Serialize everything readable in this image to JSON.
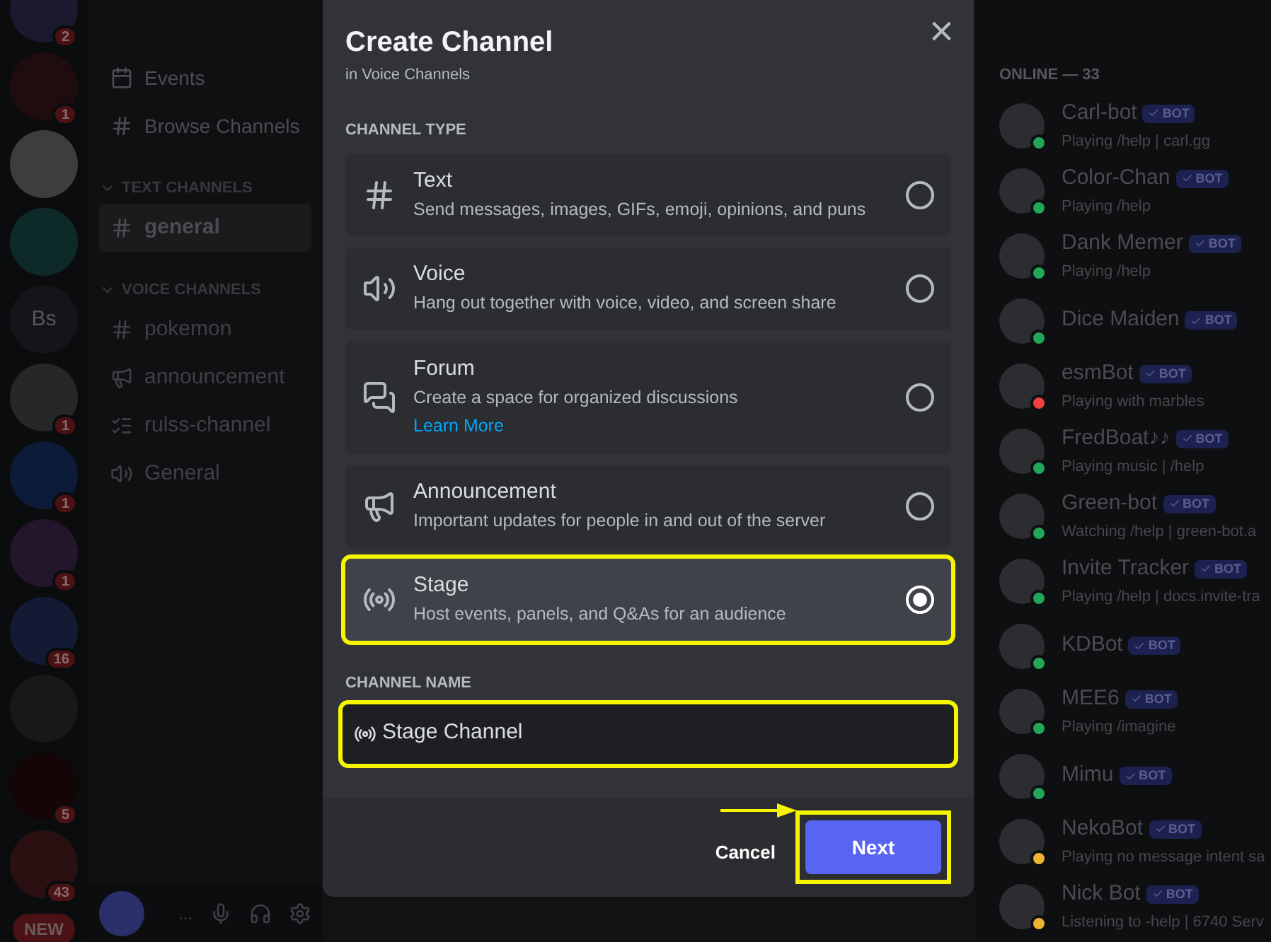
{
  "servers": [
    {
      "kind": "avatar",
      "color": "#1c1830",
      "badge": "2"
    },
    {
      "kind": "avatar",
      "color": "#1e0c0e",
      "badge": "1"
    },
    {
      "kind": "avatar",
      "color": "#3c3d3e"
    },
    {
      "kind": "avatar",
      "color": "#0e2a28"
    },
    {
      "kind": "initials",
      "initials": "Bs",
      "color": "#141518"
    },
    {
      "kind": "avatar",
      "color": "#262729",
      "badge": "1"
    },
    {
      "kind": "avatar",
      "color": "#0c1c38",
      "badge": "1"
    },
    {
      "kind": "avatar",
      "color": "#24162a",
      "badge": "1"
    },
    {
      "kind": "avatar",
      "color": "#141a34",
      "badge": "16"
    },
    {
      "kind": "avatar",
      "color": "#18181a"
    },
    {
      "kind": "avatar",
      "color": "#140506",
      "badge": "5"
    },
    {
      "kind": "avatar",
      "color": "#2a1010",
      "badge": "43"
    },
    {
      "kind": "pill",
      "label": "NEW"
    }
  ],
  "channels": {
    "top_items": [
      {
        "kind": "events",
        "label": "Events"
      },
      {
        "kind": "browse",
        "label": "Browse Channels"
      }
    ],
    "categories": [
      {
        "title": "TEXT CHANNELS",
        "expanded": true,
        "children": [
          {
            "kind": "text",
            "name": "general",
            "selected": true
          }
        ]
      },
      {
        "title": "VOICE CHANNELS",
        "expanded": true,
        "children": [
          {
            "kind": "text",
            "name": "pokemon",
            "selected": false
          },
          {
            "kind": "announcement",
            "name": "announcement",
            "selected": false
          },
          {
            "kind": "rules",
            "name": "rulss-channel",
            "selected": false
          },
          {
            "kind": "voice",
            "name": "General",
            "selected": false
          }
        ]
      }
    ],
    "user_bar": {
      "menu": "..."
    }
  },
  "members": {
    "heading": "ONLINE — 33",
    "items": [
      {
        "name": "Carl-bot",
        "tag": "BOT",
        "activity": "Playing /help | carl.gg",
        "color": "#23a55a"
      },
      {
        "name": "Color-Chan",
        "tag": "BOT",
        "activity": "Playing /help",
        "color": "#23a55a"
      },
      {
        "name": "Dank Memer",
        "tag": "BOT",
        "activity": "Playing /help",
        "color": "#23a55a"
      },
      {
        "name": "Dice Maiden",
        "tag": "BOT",
        "color": "#23a55a"
      },
      {
        "name": "esmBot",
        "tag": "BOT",
        "activity": "Playing with marbles",
        "color": "#f23f43"
      },
      {
        "name": "FredBoat♪♪",
        "tag": "BOT",
        "activity": "Playing music | /help",
        "color": "#23a55a"
      },
      {
        "name": "Green-bot",
        "tag": "BOT",
        "activity": "Watching /help | green-bot.a",
        "color": "#23a55a"
      },
      {
        "name": "Invite Tracker",
        "tag": "BOT",
        "activity": "Playing /help | docs.invite-tra",
        "color": "#23a55a"
      },
      {
        "name": "KDBot",
        "tag": "BOT",
        "color": "#23a55a"
      },
      {
        "name": "MEE6",
        "tag": "BOT",
        "activity": "Playing /imagine",
        "color": "#23a55a"
      },
      {
        "name": "Mimu",
        "tag": "BOT",
        "color": "#23a55a"
      },
      {
        "name": "NekoBot",
        "tag": "BOT",
        "activity": "Playing no message intent sa",
        "color": "#f0b232"
      },
      {
        "name": "Nick Bot",
        "tag": "BOT",
        "activity": "Listening to -help | 6740 Serv",
        "color": "#f0b232"
      }
    ]
  },
  "modal": {
    "title": "Create Channel",
    "subtitle": "in Voice Channels",
    "close": "×",
    "type_label": "CHANNEL TYPE",
    "types": [
      {
        "kind": "text",
        "name": "Text",
        "description": "Send messages, images, GIFs, emoji, opinions, and puns",
        "selected": false,
        "highlighted": false
      },
      {
        "kind": "voice",
        "name": "Voice",
        "description": "Hang out together with voice, video, and screen share",
        "selected": false,
        "highlighted": false
      },
      {
        "kind": "forum",
        "name": "Forum",
        "description": "Create a space for organized discussions",
        "link": "Learn More",
        "selected": false,
        "highlighted": false
      },
      {
        "kind": "announcement",
        "name": "Announcement",
        "description": "Important updates for people in and out of the server",
        "selected": false,
        "highlighted": false
      },
      {
        "kind": "stage",
        "name": "Stage",
        "description": "Host events, panels, and Q&As for an audience",
        "selected": true,
        "highlighted": true
      }
    ],
    "name_label": "CHANNEL NAME",
    "name_field": {
      "value": "Stage Channel",
      "highlighted": true
    },
    "cancel": {
      "label": "Cancel",
      "arrow": true
    },
    "next": {
      "label": "Next",
      "highlighted": true
    }
  }
}
